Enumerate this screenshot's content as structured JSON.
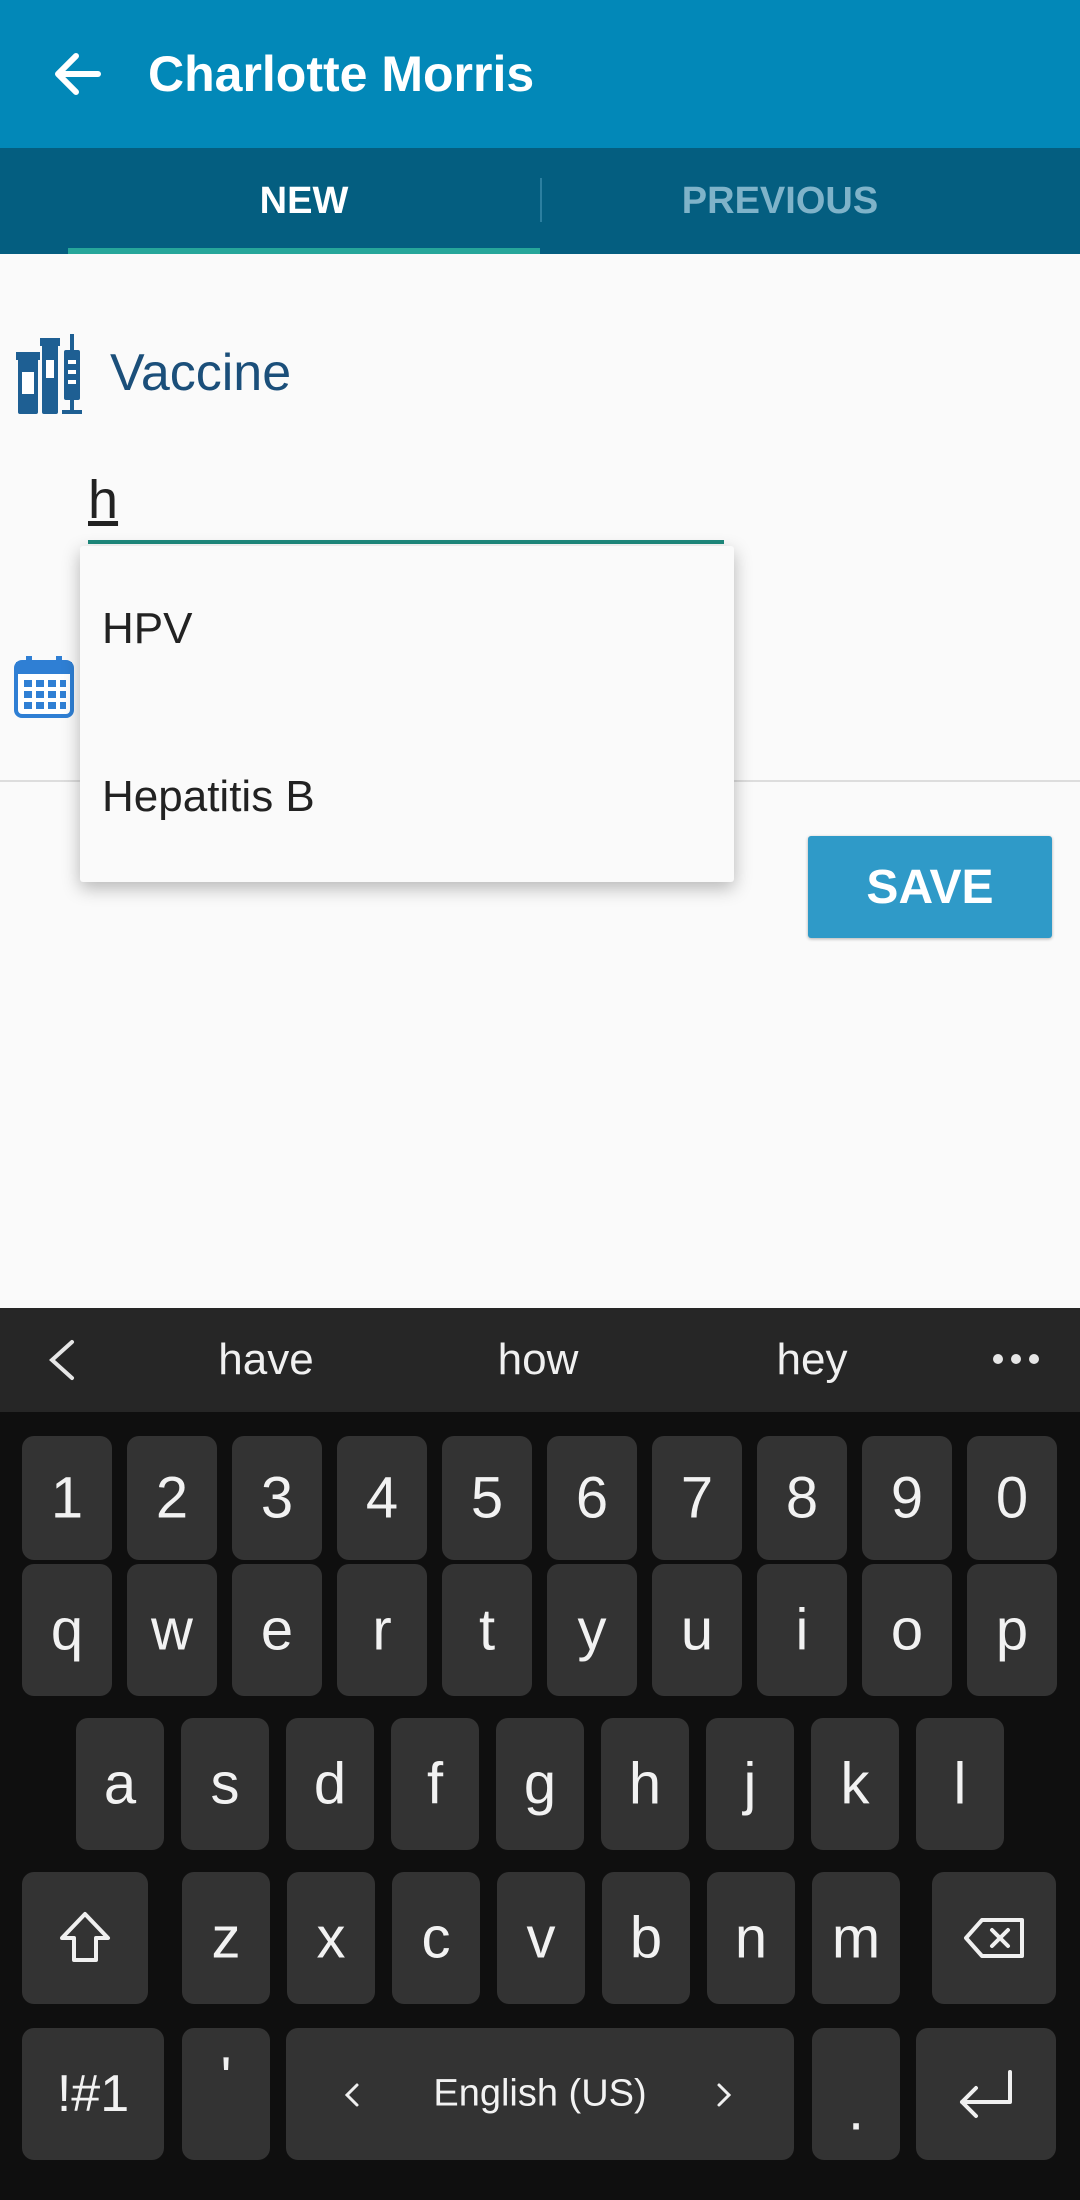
{
  "app": {
    "title": "Charlotte Morris",
    "back_icon": "arrow-back-icon"
  },
  "tabs": [
    {
      "label": "NEW",
      "active": true
    },
    {
      "label": "PREVIOUS",
      "active": false
    }
  ],
  "form": {
    "vaccine_label": "Vaccine",
    "vaccine_icon": "vaccine-vials-syringe-icon",
    "vaccine_input_value": "h",
    "date_icon": "calendar-icon"
  },
  "dropdown": {
    "options": [
      "HPV",
      "Hepatitis B"
    ]
  },
  "actions": {
    "save_label": "SAVE"
  },
  "keyboard": {
    "suggestions": [
      "have",
      "how",
      "hey"
    ],
    "row_numbers": [
      "1",
      "2",
      "3",
      "4",
      "5",
      "6",
      "7",
      "8",
      "9",
      "0"
    ],
    "row_q": [
      "q",
      "w",
      "e",
      "r",
      "t",
      "y",
      "u",
      "i",
      "o",
      "p"
    ],
    "row_a": [
      "a",
      "s",
      "d",
      "f",
      "g",
      "h",
      "j",
      "k",
      "l"
    ],
    "row_z": [
      "z",
      "x",
      "c",
      "v",
      "b",
      "n",
      "m"
    ],
    "symbols_label": "!#1",
    "apostrophe": "'",
    "space_label": "English (US)",
    "period": "."
  },
  "colors": {
    "appbar": "#0288b8",
    "tabbar": "#045e80",
    "accent": "#26a69a",
    "save": "#2f9ac8"
  }
}
